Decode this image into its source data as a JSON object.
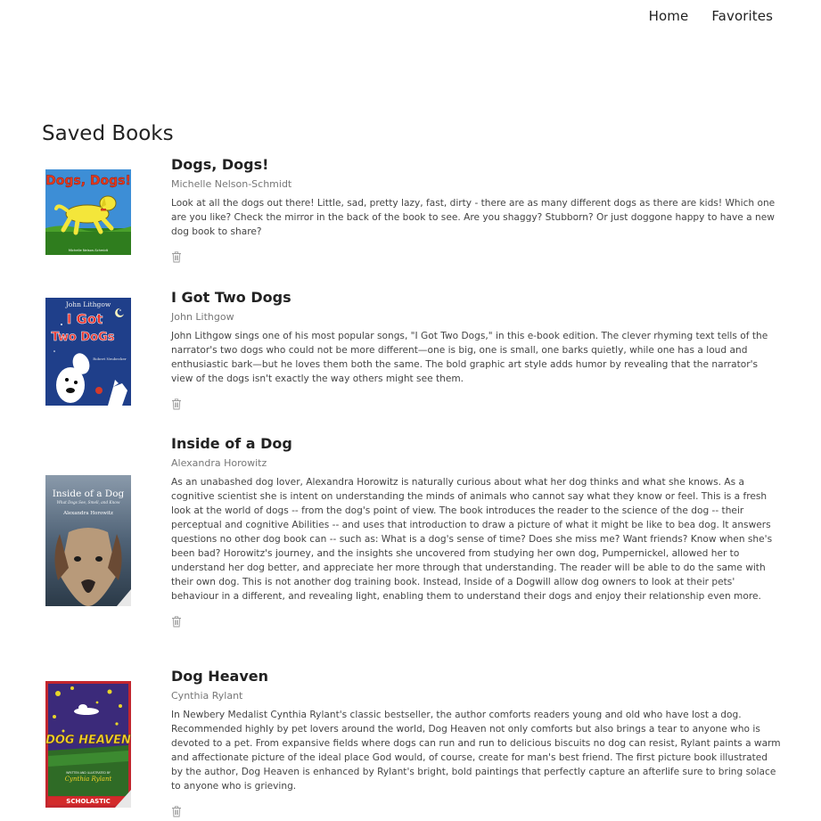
{
  "nav": {
    "home": "Home",
    "favorites": "Favorites"
  },
  "page_title": "Saved Books",
  "books": [
    {
      "title": "Dogs, Dogs!",
      "author": "Michelle Nelson-Schmidt",
      "description": "Look at all the dogs out there! Little, sad, pretty lazy, fast, dirty - there are as many different dogs as there are kids! Which one are you like? Check the mirror in the back of the book to see. Are you shaggy? Stubborn? Or just doggone happy to have a new dog book to share?",
      "cover": {
        "title": "Dogs, Dogs!",
        "author": "Michelle Nelson-Schmidt"
      }
    },
    {
      "title": "I Got Two Dogs",
      "author": "John Lithgow",
      "description": "John Lithgow sings one of his most popular songs, \"I Got Two Dogs,\" in this e-book edition. The clever rhyming text tells of the narrator's two dogs who could not be more different—one is big, one is small, one barks quietly, while one has a loud and enthusiastic bark—but he loves them both the same. The bold graphic art style adds humor by revealing that the narrator's view of the dogs isn't exactly the way others might see them.",
      "cover": {
        "author": "John Lithgow",
        "title_line1": "I Got",
        "title_line2": "Two DoGs",
        "illustrator": "Robert Neubecker"
      }
    },
    {
      "title": "Inside of a Dog",
      "author": "Alexandra Horowitz",
      "description": "As an unabashed dog lover, Alexandra Horowitz is naturally curious about what her dog thinks and what she knows. As a cognitive scientist she is intent on understanding the minds of animals who cannot say what they know or feel. This is a fresh look at the world of dogs -- from the dog's point of view. The book introduces the reader to the science of the dog -- their perceptual and cognitive Abilities -- and uses that introduction to draw a picture of what it might be like to bea dog. It answers questions no other dog book can -- such as: What is a dog's sense of time? Does she miss me? Want friends? Know when she's been bad? Horowitz's journey, and the insights she uncovered from studying her own dog, Pumpernickel, allowed her to understand her dog better, and appreciate her more through that understanding. The reader will be able to do the same with their own dog. This is not another dog training book. Instead, Inside of a Dogwill allow dog owners to look at their pets' behaviour in a different, and revealing light, enabling them to understand their dogs and enjoy their relationship even more.",
      "cover": {
        "title": "Inside of a Dog",
        "subtitle": "What Dogs See, Smell, and Know",
        "author": "Alexandra Horowitz"
      }
    },
    {
      "title": "Dog Heaven",
      "author": "Cynthia Rylant",
      "description": "In Newbery Medalist Cynthia Rylant's classic bestseller, the author comforts readers young and old who have lost a dog. Recommended highly by pet lovers around the world, Dog Heaven not only comforts but also brings a tear to anyone who is devoted to a pet. From expansive fields where dogs can run and run to delicious biscuits no dog can resist, Rylant paints a warm and affectionate picture of the ideal place God would, of course, create for man's best friend. The first picture book illustrated by the author, Dog Heaven is enhanced by Rylant's bright, bold paintings that perfectly capture an afterlife sure to bring solace to anyone who is grieving.",
      "cover": {
        "title": "DOG HEAVEN",
        "author": "Cynthia Rylant",
        "byline": "WRITTEN AND ILLUSTRATED BY",
        "publisher": "SCHOLASTIC"
      }
    }
  ]
}
